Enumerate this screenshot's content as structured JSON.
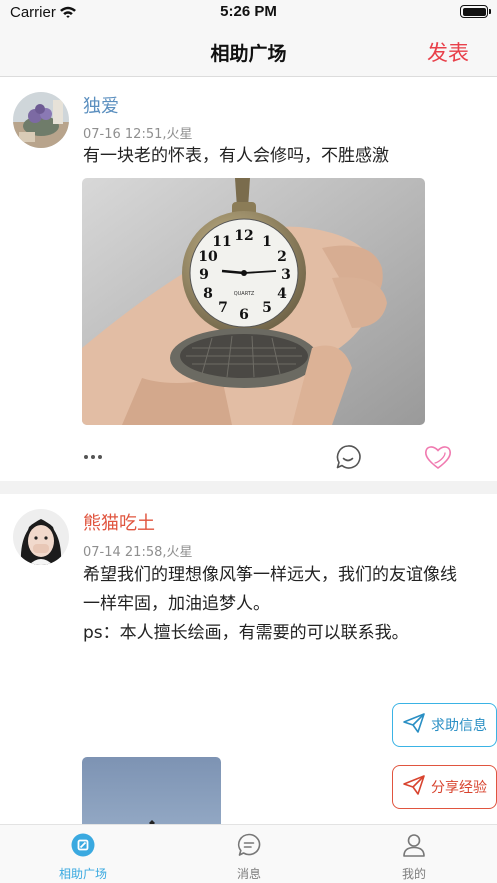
{
  "status_bar": {
    "carrier": "Carrier",
    "time": "5:26 PM"
  },
  "nav": {
    "title": "相助广场",
    "publish_label": "发表"
  },
  "posts": [
    {
      "user_name": "独爱",
      "name_color": "#5b8fbf",
      "time": "07-16 12:51,火星",
      "text": "有一块老的怀表，有人会修吗，不胜感激",
      "image": "pocket-watch-photo"
    },
    {
      "user_name": "熊猫吃土",
      "name_color": "#e0553f",
      "time": "07-14 21:58,火星",
      "text": "希望我们的理想像风筝一样远大，我们的友谊像线一样牢固，加油追梦人。\nps：本人擅长绘画，有需要的可以联系我。",
      "image": "kite-sky-photo"
    }
  ],
  "floating_buttons": {
    "help_label": "求助信息",
    "share_label": "分享经验"
  },
  "tabs": [
    {
      "label": "相助广场",
      "icon": "compass-icon",
      "active": true
    },
    {
      "label": "消息",
      "icon": "chat-icon",
      "active": false
    },
    {
      "label": "我的",
      "icon": "person-icon",
      "active": false
    }
  ],
  "colors": {
    "accent": "#3aa9e0",
    "publish": "#e8404a",
    "like": "#f07ab0"
  }
}
